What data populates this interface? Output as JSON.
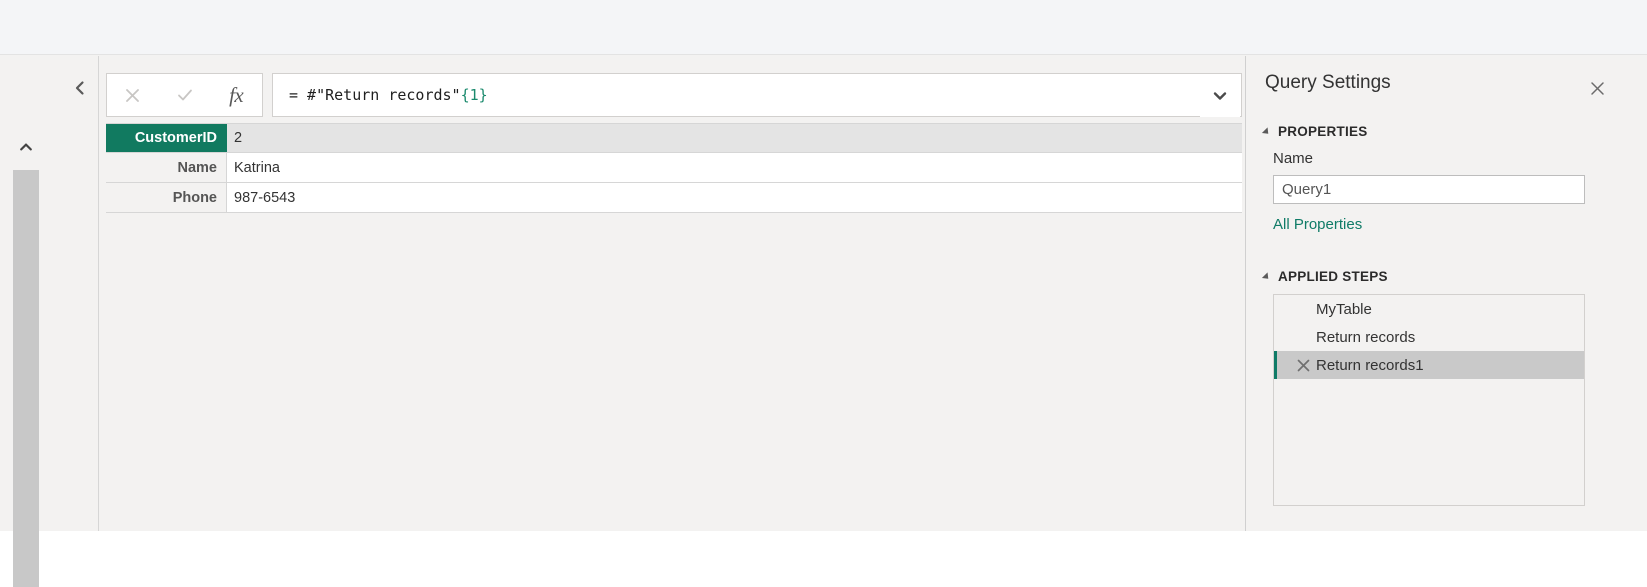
{
  "formula_bar": {
    "cancel_icon": "close-icon",
    "commit_icon": "check-icon",
    "fx_label": "fx",
    "formula_prefix": "= #\"Return records\"",
    "formula_index": "{1}",
    "formula_full": "= #\"Return records\"{1}",
    "dropdown_icon": "chevron-down-icon"
  },
  "left_rail": {
    "expand_icon": "chevron-left-icon",
    "scroll_up_icon": "chevron-up-icon"
  },
  "record_grid": {
    "rows": [
      {
        "field": "CustomerID",
        "value": "2",
        "selected": true
      },
      {
        "field": "Name",
        "value": "Katrina",
        "selected": false
      },
      {
        "field": "Phone",
        "value": "987-6543",
        "selected": false
      }
    ]
  },
  "query_settings": {
    "title": "Query Settings",
    "close_icon": "close-icon",
    "properties": {
      "section_label": "PROPERTIES",
      "name_label": "Name",
      "name_value": "Query1",
      "name_placeholder": "Query1",
      "all_properties_link": "All Properties"
    },
    "applied_steps": {
      "section_label": "APPLIED STEPS",
      "steps": [
        {
          "label": "MyTable",
          "selected": false,
          "has_delete": false
        },
        {
          "label": "Return records",
          "selected": false,
          "has_delete": false
        },
        {
          "label": "Return records1",
          "selected": true,
          "has_delete": true,
          "delete_icon": "delete-step-icon"
        }
      ]
    }
  },
  "colors": {
    "accent_teal": "#117a60",
    "link_teal": "#0f7b67",
    "panel_bg": "#f3f2f1",
    "selected_row_bg": "#e4e4e4",
    "selected_step_bg": "#c9c9c9"
  }
}
